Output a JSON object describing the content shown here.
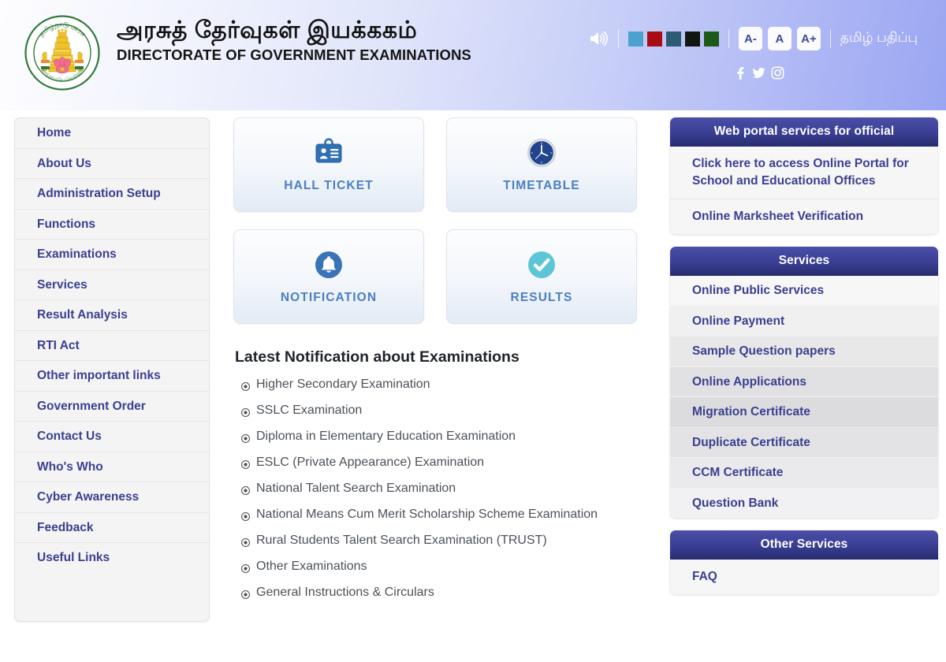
{
  "header": {
    "title_tamil": "அரசுத் தேர்வுகள் இயக்ககம்",
    "title_english": "DIRECTORATE OF GOVERNMENT EXAMINATIONS",
    "emblem_name": "tamil-nadu-state-emblem",
    "speaker_icon": "speaker-icon",
    "language_link": "தமிழ் பதிப்பு",
    "theme_swatches": [
      {
        "name": "swatch-light-blue",
        "color": "#4aa3cf"
      },
      {
        "name": "swatch-dark-red",
        "color": "#a80c14"
      },
      {
        "name": "swatch-steel-blue",
        "color": "#2d5a75"
      },
      {
        "name": "swatch-black",
        "color": "#111611"
      },
      {
        "name": "swatch-dark-green",
        "color": "#1d5a17"
      }
    ],
    "font_buttons": [
      {
        "name": "font-decrease-button",
        "label": "A-"
      },
      {
        "name": "font-reset-button",
        "label": "A"
      },
      {
        "name": "font-increase-button",
        "label": "A+"
      }
    ],
    "social": [
      {
        "name": "facebook-icon",
        "label": "Facebook"
      },
      {
        "name": "twitter-icon",
        "label": "Twitter"
      },
      {
        "name": "instagram-icon",
        "label": "Instagram"
      }
    ]
  },
  "sidebar": {
    "items": [
      {
        "label": "Home"
      },
      {
        "label": "About Us"
      },
      {
        "label": "Administration Setup"
      },
      {
        "label": "Functions"
      },
      {
        "label": "Examinations"
      },
      {
        "label": "Services"
      },
      {
        "label": "Result Analysis"
      },
      {
        "label": "RTI Act"
      },
      {
        "label": "Other important links"
      },
      {
        "label": "Government Order"
      },
      {
        "label": "Contact Us"
      },
      {
        "label": "Who's Who"
      },
      {
        "label": "Cyber Awareness"
      },
      {
        "label": "Feedback"
      },
      {
        "label": "Useful Links"
      }
    ]
  },
  "tiles": [
    {
      "label": "HALL TICKET",
      "icon": "id-badge-icon"
    },
    {
      "label": "TIMETABLE",
      "icon": "clock-icon"
    },
    {
      "label": "NOTIFICATION",
      "icon": "bell-icon"
    },
    {
      "label": "RESULTS",
      "icon": "check-circle-icon"
    }
  ],
  "notifications": {
    "title": "Latest Notification about Examinations",
    "items": [
      {
        "label": "Higher Secondary Examination"
      },
      {
        "label": "SSLC Examination"
      },
      {
        "label": "Diploma in Elementary Education Examination"
      },
      {
        "label": "ESLC (Private Appearance) Examination"
      },
      {
        "label": "National Talent Search Examination"
      },
      {
        "label": "National Means Cum Merit Scholarship Scheme Examination"
      },
      {
        "label": "Rural Students Talent Search Examination (TRUST)"
      },
      {
        "label": "Other Examinations"
      },
      {
        "label": "General Instructions & Circulars"
      }
    ]
  },
  "web_portal": {
    "heading": "Web portal services for official",
    "links": [
      {
        "label": "Click here to access Online Portal for School and Educational Offices"
      },
      {
        "label": "Online Marksheet Verification"
      }
    ]
  },
  "services": {
    "heading": "Services",
    "items": [
      {
        "label": "Online Public Services"
      },
      {
        "label": "Online Payment"
      },
      {
        "label": "Sample Question papers"
      },
      {
        "label": "Online Applications"
      },
      {
        "label": "Migration Certificate"
      },
      {
        "label": "Duplicate Certificate"
      },
      {
        "label": "CCM Certificate"
      },
      {
        "label": "Question Bank"
      }
    ]
  },
  "other_services": {
    "heading": "Other Services",
    "items": [
      {
        "label": "FAQ"
      }
    ]
  },
  "colors": {
    "panel_header_blue": "#3a3f94",
    "link_indigo": "#3b3f8f",
    "tile_label_blue": "#4a7fc1",
    "results_teal": "#5cc6d8",
    "header_gradient_end": "#9aa6f2"
  }
}
